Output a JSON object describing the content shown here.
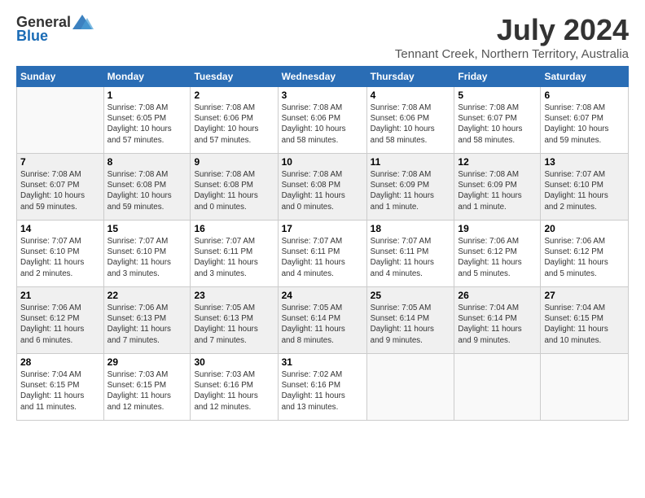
{
  "logo": {
    "general": "General",
    "blue": "Blue"
  },
  "title": "July 2024",
  "location": "Tennant Creek, Northern Territory, Australia",
  "days": [
    "Sunday",
    "Monday",
    "Tuesday",
    "Wednesday",
    "Thursday",
    "Friday",
    "Saturday"
  ],
  "weeks": [
    [
      {
        "date": "",
        "info": ""
      },
      {
        "date": "1",
        "info": "Sunrise: 7:08 AM\nSunset: 6:05 PM\nDaylight: 10 hours\nand 57 minutes."
      },
      {
        "date": "2",
        "info": "Sunrise: 7:08 AM\nSunset: 6:06 PM\nDaylight: 10 hours\nand 57 minutes."
      },
      {
        "date": "3",
        "info": "Sunrise: 7:08 AM\nSunset: 6:06 PM\nDaylight: 10 hours\nand 58 minutes."
      },
      {
        "date": "4",
        "info": "Sunrise: 7:08 AM\nSunset: 6:06 PM\nDaylight: 10 hours\nand 58 minutes."
      },
      {
        "date": "5",
        "info": "Sunrise: 7:08 AM\nSunset: 6:07 PM\nDaylight: 10 hours\nand 58 minutes."
      },
      {
        "date": "6",
        "info": "Sunrise: 7:08 AM\nSunset: 6:07 PM\nDaylight: 10 hours\nand 59 minutes."
      }
    ],
    [
      {
        "date": "7",
        "info": "Sunrise: 7:08 AM\nSunset: 6:07 PM\nDaylight: 10 hours\nand 59 minutes."
      },
      {
        "date": "8",
        "info": "Sunrise: 7:08 AM\nSunset: 6:08 PM\nDaylight: 10 hours\nand 59 minutes."
      },
      {
        "date": "9",
        "info": "Sunrise: 7:08 AM\nSunset: 6:08 PM\nDaylight: 11 hours\nand 0 minutes."
      },
      {
        "date": "10",
        "info": "Sunrise: 7:08 AM\nSunset: 6:08 PM\nDaylight: 11 hours\nand 0 minutes."
      },
      {
        "date": "11",
        "info": "Sunrise: 7:08 AM\nSunset: 6:09 PM\nDaylight: 11 hours\nand 1 minute."
      },
      {
        "date": "12",
        "info": "Sunrise: 7:08 AM\nSunset: 6:09 PM\nDaylight: 11 hours\nand 1 minute."
      },
      {
        "date": "13",
        "info": "Sunrise: 7:07 AM\nSunset: 6:10 PM\nDaylight: 11 hours\nand 2 minutes."
      }
    ],
    [
      {
        "date": "14",
        "info": "Sunrise: 7:07 AM\nSunset: 6:10 PM\nDaylight: 11 hours\nand 2 minutes."
      },
      {
        "date": "15",
        "info": "Sunrise: 7:07 AM\nSunset: 6:10 PM\nDaylight: 11 hours\nand 3 minutes."
      },
      {
        "date": "16",
        "info": "Sunrise: 7:07 AM\nSunset: 6:11 PM\nDaylight: 11 hours\nand 3 minutes."
      },
      {
        "date": "17",
        "info": "Sunrise: 7:07 AM\nSunset: 6:11 PM\nDaylight: 11 hours\nand 4 minutes."
      },
      {
        "date": "18",
        "info": "Sunrise: 7:07 AM\nSunset: 6:11 PM\nDaylight: 11 hours\nand 4 minutes."
      },
      {
        "date": "19",
        "info": "Sunrise: 7:06 AM\nSunset: 6:12 PM\nDaylight: 11 hours\nand 5 minutes."
      },
      {
        "date": "20",
        "info": "Sunrise: 7:06 AM\nSunset: 6:12 PM\nDaylight: 11 hours\nand 5 minutes."
      }
    ],
    [
      {
        "date": "21",
        "info": "Sunrise: 7:06 AM\nSunset: 6:12 PM\nDaylight: 11 hours\nand 6 minutes."
      },
      {
        "date": "22",
        "info": "Sunrise: 7:06 AM\nSunset: 6:13 PM\nDaylight: 11 hours\nand 7 minutes."
      },
      {
        "date": "23",
        "info": "Sunrise: 7:05 AM\nSunset: 6:13 PM\nDaylight: 11 hours\nand 7 minutes."
      },
      {
        "date": "24",
        "info": "Sunrise: 7:05 AM\nSunset: 6:14 PM\nDaylight: 11 hours\nand 8 minutes."
      },
      {
        "date": "25",
        "info": "Sunrise: 7:05 AM\nSunset: 6:14 PM\nDaylight: 11 hours\nand 9 minutes."
      },
      {
        "date": "26",
        "info": "Sunrise: 7:04 AM\nSunset: 6:14 PM\nDaylight: 11 hours\nand 9 minutes."
      },
      {
        "date": "27",
        "info": "Sunrise: 7:04 AM\nSunset: 6:15 PM\nDaylight: 11 hours\nand 10 minutes."
      }
    ],
    [
      {
        "date": "28",
        "info": "Sunrise: 7:04 AM\nSunset: 6:15 PM\nDaylight: 11 hours\nand 11 minutes."
      },
      {
        "date": "29",
        "info": "Sunrise: 7:03 AM\nSunset: 6:15 PM\nDaylight: 11 hours\nand 12 minutes."
      },
      {
        "date": "30",
        "info": "Sunrise: 7:03 AM\nSunset: 6:16 PM\nDaylight: 11 hours\nand 12 minutes."
      },
      {
        "date": "31",
        "info": "Sunrise: 7:02 AM\nSunset: 6:16 PM\nDaylight: 11 hours\nand 13 minutes."
      },
      {
        "date": "",
        "info": ""
      },
      {
        "date": "",
        "info": ""
      },
      {
        "date": "",
        "info": ""
      }
    ]
  ]
}
